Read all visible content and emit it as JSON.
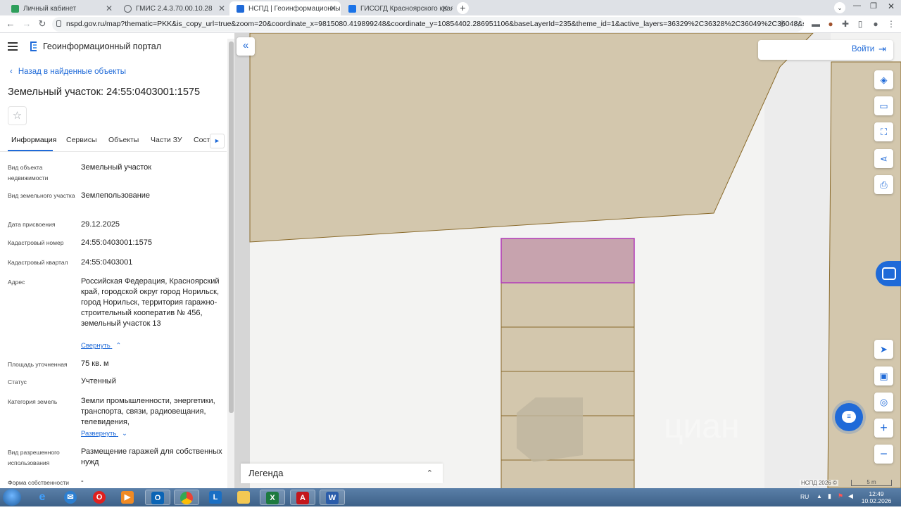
{
  "browser": {
    "tabs": [
      {
        "title": "Личный кабинет",
        "color": "#2e9e5b",
        "active": false
      },
      {
        "title": "ГМИС 2.4.3.70.00.10.28",
        "color": "#5f6368",
        "active": false
      },
      {
        "title": "НСПД | Геоинформационный п",
        "color": "#1f6ad8",
        "active": true
      },
      {
        "title": "ГИСОГД Красноярского края",
        "color": "#1a73e8",
        "active": false
      }
    ],
    "new_tab": "+",
    "url": "nspd.gov.ru/map?thematic=PKK&is_copy_url=true&zoom=20&coordinate_x=9815080.419899248&coordinate_y=10854402.286951106&baseLayerId=235&theme_id=1&active_layers=36329%2C36328%2C36049%2C36048&selectedCard=129..."
  },
  "header": {
    "portal_title": "Геоинформационный портал",
    "back_link": "Назад в найденные объекты"
  },
  "parcel": {
    "title": "Земельный участок: 24:55:0403001:1575",
    "tabs": [
      "Информация",
      "Сервисы",
      "Объекты",
      "Части ЗУ",
      "Соста"
    ],
    "fields": [
      {
        "label": "Вид объекта недвижимости",
        "value": "Земельный участок"
      },
      {
        "label": "Вид земельного участка",
        "value": "Землепользование"
      },
      {
        "label": "Дата присвоения",
        "value": "29.12.2025"
      },
      {
        "label": "Кадастровый номер",
        "value": "24:55:0403001:1575"
      },
      {
        "label": "Кадастровый квартал",
        "value": "24:55:0403001"
      },
      {
        "label": "Адрес",
        "value": "Российская Федерация, Красноярский край, городской округ город Норильск, город Норильск, территория гаражно-строительный кооператив № 456, земельный участок 13"
      },
      {
        "label": "Площадь уточненная",
        "value": "75 кв. м"
      },
      {
        "label": "Статус",
        "value": "Учтенный"
      },
      {
        "label": "Категория земель",
        "value": "Земли промышленности, энергетики, транспорта, связи, радиовещания, телевидения,"
      },
      {
        "label": "Вид разрешенного использования",
        "value": "Размещение гаражей для собственных нужд"
      },
      {
        "label": "Форма собственности",
        "value": "-"
      }
    ],
    "collapse_link": "Свернуть",
    "expand_link": "Развернуть"
  },
  "map": {
    "login_label": "Войти",
    "legend_label": "Легенда",
    "attribution": "НСПД 2026 ©",
    "scale_label": "5 m",
    "colors": {
      "accent": "#1f6ad8",
      "parcel_fill": "#d3c7ad",
      "parcel_stroke": "#8a6a2a",
      "selected_fill": "#c7a3ae",
      "selected_stroke": "#b23bb8",
      "road": "#f4f4f4"
    },
    "tools": [
      "layers-icon",
      "ruler-icon",
      "select-area-icon",
      "share-icon",
      "print-icon",
      "navigate-icon",
      "overview-map-icon",
      "locate-icon",
      "zoom-in-icon",
      "zoom-out-icon"
    ]
  },
  "taskbar": {
    "apps": [
      "ie-icon",
      "thunderbird-icon",
      "opera-icon",
      "media-player-icon",
      "outlook-icon",
      "chrome-icon",
      "lync-icon",
      "explorer-icon",
      "excel-icon",
      "acrobat-icon",
      "word-icon"
    ],
    "lang": "RU",
    "time": "12:49",
    "date": "10.02.2026"
  }
}
